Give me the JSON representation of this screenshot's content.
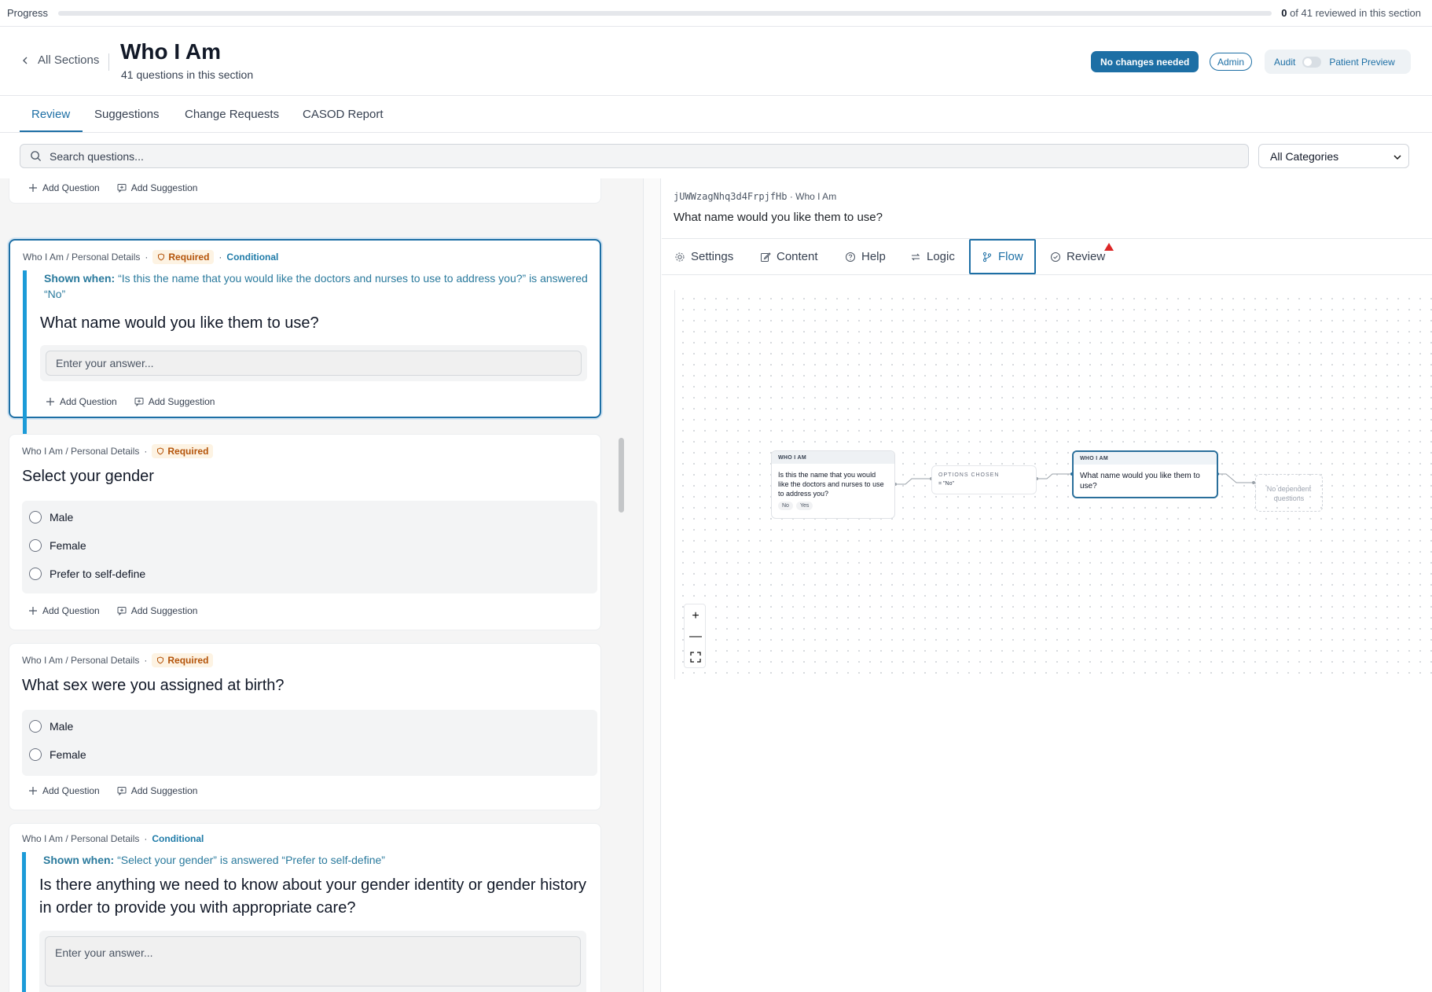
{
  "progress": {
    "label": "Progress",
    "reviewed_count": "0",
    "summary_suffix": " of 41 reviewed in this section",
    "fraction": 0
  },
  "header": {
    "back_label": "All Sections",
    "title": "Who I Am",
    "subtitle": "41 questions in this section",
    "no_changes_label": "No changes needed",
    "admin_badge": "Admin",
    "audit_label": "Audit",
    "patient_preview_label": "Patient Preview"
  },
  "tabs": [
    "Review",
    "Suggestions",
    "Change Requests",
    "CASOD Report"
  ],
  "search": {
    "placeholder": "Search questions...",
    "category": "All Categories"
  },
  "actions": {
    "add_question": "Add Question",
    "add_suggestion": "Add Suggestion"
  },
  "questions": [
    {
      "path": "Who I Am / Personal Details",
      "required": "Required",
      "conditional": "Conditional",
      "shown_when_label": "Shown when:",
      "shown_when_text": " “Is this the name that you would like the doctors and nurses to use to address you?” is answered “No”",
      "title": "What name would you like them to use?",
      "placeholder": "Enter your answer..."
    },
    {
      "path": "Who I Am / Personal Details",
      "required": "Required",
      "title": "Select your gender",
      "options": [
        "Male",
        "Female",
        "Prefer to self-define"
      ]
    },
    {
      "path": "Who I Am / Personal Details",
      "required": "Required",
      "title": "What sex were you assigned at birth?",
      "options": [
        "Male",
        "Female"
      ]
    },
    {
      "path": "Who I Am / Personal Details",
      "conditional": "Conditional",
      "shown_when_label": "Shown when:",
      "shown_when_text": " “Select your gender” is answered “Prefer to self-define”",
      "title": "Is there anything we need to know about your gender identity or gender history in order to provide you with appropriate care?",
      "placeholder": "Enter your answer..."
    }
  ],
  "detail": {
    "question_id": "jUWWzagNhq3d4FrpjfHb",
    "section": "Who I Am",
    "question": "What name would you like them to use?",
    "tabs": [
      "Settings",
      "Content",
      "Help",
      "Logic",
      "Flow",
      "Review"
    ],
    "active_tab": "Flow"
  },
  "flow": {
    "source_node": {
      "header": "WHO I AM",
      "text": "Is this the name that you would like the doctors and nurses to use to address you?",
      "chips": [
        "No",
        "Yes"
      ]
    },
    "condition_node": {
      "label": "OPTIONS CHOSEN",
      "value": "= \"No\""
    },
    "target_node": {
      "header": "WHO I AM",
      "text": "What name would you like them to use?"
    },
    "empty_node": {
      "text": "No dependent questions"
    },
    "zoom_in": "+",
    "zoom_out": "—"
  }
}
